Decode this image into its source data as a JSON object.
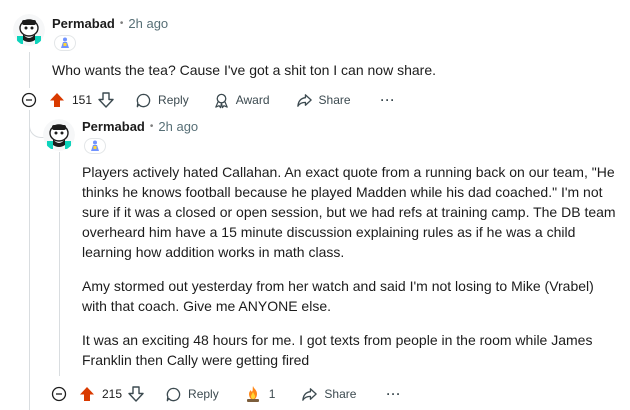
{
  "colors": {
    "upvote_active": "#d93a00",
    "thread_line": "#d9dde0",
    "muted_text": "#576f76",
    "text": "#1c1c1c"
  },
  "comments": [
    {
      "username": "Permabad",
      "separator": "•",
      "timestamp": "2h ago",
      "flair_icon": "avatar-figure-icon",
      "paragraphs": [
        "Who wants the tea? Cause I've got a shit ton I can now share."
      ],
      "votes": "151",
      "upvoted": true,
      "actions": {
        "reply": "Reply",
        "award": "Award",
        "share": "Share"
      },
      "overflow": "···"
    },
    {
      "username": "Permabad",
      "separator": "•",
      "timestamp": "2h ago",
      "flair_icon": "avatar-figure-icon",
      "paragraphs": [
        "Players actively hated Callahan. An exact quote from a running back on our team, \"He thinks he knows football because he played Madden while his dad coached.\" I'm not sure if it was a closed or open session, but we had refs at training camp. The DB team overheard him have a 15 minute discussion explaining rules as if he was a child learning how addition works in math class.",
        "Amy stormed out yesterday from her watch and said I'm not losing to Mike (Vrabel) with that coach. Give me ANYONE else.",
        "It was an exciting 48 hours for me. I got texts from people in the room while James Franklin then Cally were getting fired"
      ],
      "votes": "215",
      "upvoted": true,
      "award_count": "1",
      "actions": {
        "reply": "Reply",
        "share": "Share"
      },
      "overflow": "···"
    }
  ]
}
